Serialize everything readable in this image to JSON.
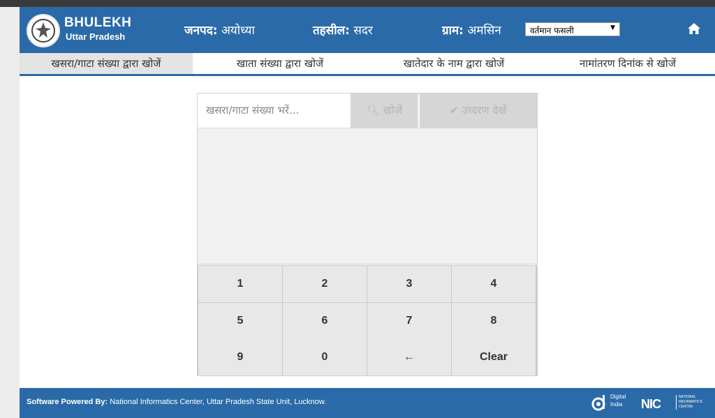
{
  "header": {
    "brand_title": "BHULEKH",
    "brand_subtitle": "Uttar Pradesh",
    "district_label": "जनपद:",
    "district_value": "अयोध्या",
    "tehsil_label": "तहसील:",
    "tehsil_value": "सदर",
    "village_label": "ग्राम:",
    "village_value": "अमसिन",
    "season_select": "वर्तमान फसली",
    "home_icon": "home-icon",
    "logo_icon": "up-emblem-icon",
    "bg_color": "#2b6aa8"
  },
  "tabs": [
    {
      "label": "खसरा/गाटा संख्या द्वारा खोजें",
      "active": true
    },
    {
      "label": "खाता संख्या द्वारा खोजें",
      "active": false
    },
    {
      "label": "खातेदार के नाम द्वारा खोजें",
      "active": false
    },
    {
      "label": "नामांतरण दिनांक से खोजें",
      "active": false
    }
  ],
  "search": {
    "placeholder": "खसरा/गाटा संख्या भरें...",
    "search_button": "खोजें",
    "search_icon": "search-icon",
    "details_button": "उध्दरण देखें",
    "details_icon": "check-icon"
  },
  "keypad": {
    "keys": [
      "1",
      "2",
      "3",
      "4",
      "5",
      "6",
      "7",
      "8",
      "9",
      "0",
      "←",
      "Clear"
    ]
  },
  "footer": {
    "powered_label": "Software Powered By:",
    "powered_text": " National Informatics Center, Uttar Pradesh State Unit, Lucknow.",
    "digital_india_line1": "Digital",
    "digital_india_line2": "India",
    "nic_label": "NIC",
    "nic_sub_1": "NATIONAL",
    "nic_sub_2": "INFORMATICS",
    "nic_sub_3": "CENTRE"
  }
}
